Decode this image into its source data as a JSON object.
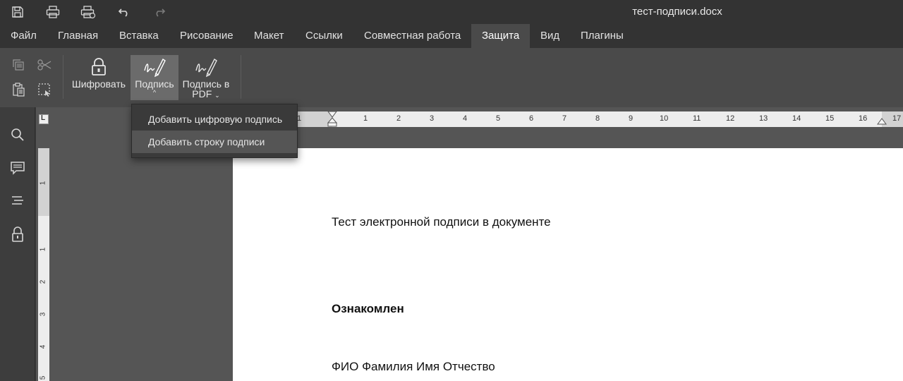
{
  "app": {
    "document_title": "тест-подписи.docx"
  },
  "quick_access": {
    "save_icon": "save-icon",
    "print_icon": "print-icon",
    "quick_print_icon": "quick-print-icon",
    "undo_icon": "undo-icon",
    "redo_icon": "redo-icon"
  },
  "menu": {
    "tabs": [
      {
        "label": "Файл"
      },
      {
        "label": "Главная"
      },
      {
        "label": "Вставка"
      },
      {
        "label": "Рисование"
      },
      {
        "label": "Макет"
      },
      {
        "label": "Ссылки"
      },
      {
        "label": "Совместная работа"
      },
      {
        "label": "Защита"
      },
      {
        "label": "Вид"
      },
      {
        "label": "Плагины"
      }
    ],
    "active_tab": "Защита"
  },
  "ribbon": {
    "encrypt_label": "Шифровать",
    "signature_label": "Подпись",
    "signature_caret": "^",
    "pdf_signature_label_line1": "Подпись в",
    "pdf_signature_label_line2": "PDF",
    "pdf_signature_caret": "⌄"
  },
  "signature_menu": {
    "items": [
      {
        "label": "Добавить цифровую подпись"
      },
      {
        "label": "Добавить строку подписи"
      }
    ]
  },
  "ruler": {
    "corner": "L",
    "horizontal_marks": [
      "1",
      "1",
      "2",
      "3",
      "4",
      "5",
      "6",
      "7",
      "8",
      "9",
      "10",
      "11",
      "12",
      "13",
      "14",
      "15",
      "16",
      "17"
    ],
    "vertical_marks": [
      "1",
      "1",
      "2",
      "3",
      "4",
      "5"
    ]
  },
  "document": {
    "paragraphs": [
      {
        "text": "Тест электронной подписи в документе"
      },
      {
        "text": "Ознакомлен"
      },
      {
        "text": "ФИО Фамилия Имя Отчество"
      }
    ]
  },
  "colors": {
    "chrome_dark": "#333333",
    "ribbon": "#4a4a4a",
    "workspace": "#555555",
    "page": "#ffffff"
  }
}
